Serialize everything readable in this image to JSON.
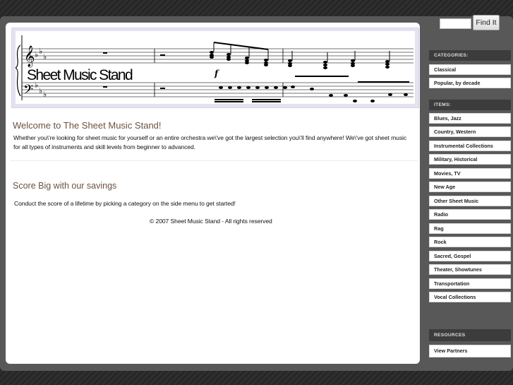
{
  "banner": {
    "title": "Sheet Music Stand",
    "dynamic_marking": "f"
  },
  "welcome": {
    "heading": "Welcome to The Sheet Music Stand!",
    "body_line1": "Whether you\\'re looking for sheet music for yourself or an entire orchestra we\\'ve got the largest selection you\\'ll find anywhere! We\\'ve got sheet music",
    "body_line2": "for all types of instruments and skill levels from beginner to advanced."
  },
  "promo": {
    "heading": "Score Big with our savings",
    "body": "Conduct the score of a lifetime by picking a category on the side menu to get started!"
  },
  "footer": {
    "copyright": "© 2007 Sheet Music Stand - All rights reserved"
  },
  "search": {
    "value": "",
    "placeholder": "",
    "button_label": "Find It"
  },
  "sidebar": {
    "categories_heading": "CATEGORIES:",
    "categories": [
      {
        "label": "Classical"
      },
      {
        "label": "Popular, by decade"
      }
    ],
    "items_heading": "ITEMS:",
    "items": [
      {
        "label": "Blues, Jazz"
      },
      {
        "label": "Country, Western"
      },
      {
        "label": "Instrumental Collections"
      },
      {
        "label": "Military, Historical"
      },
      {
        "label": "Movies, TV"
      },
      {
        "label": "New Age"
      },
      {
        "label": "Other Sheet Music"
      },
      {
        "label": "Radio"
      },
      {
        "label": "Rag"
      },
      {
        "label": "Rock"
      },
      {
        "label": "Sacred, Gospel"
      },
      {
        "label": "Theater, Showtunes"
      },
      {
        "label": "Transportation"
      },
      {
        "label": "Vocal Collections"
      }
    ],
    "resources_heading": "RESOURCES",
    "resources": [
      {
        "label": "View Partners"
      }
    ]
  },
  "colors": {
    "heading_brown": "#6b5240",
    "frame_gray": "#585858",
    "sidebar_head_bg": "#3c3c3c"
  }
}
